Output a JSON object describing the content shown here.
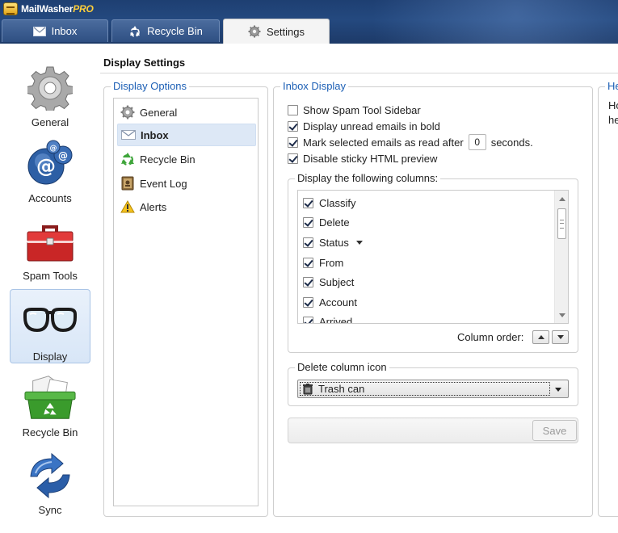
{
  "app": {
    "name_plain": "MailWasher",
    "name_brand": "PRO"
  },
  "tabs": [
    {
      "label": "Inbox",
      "icon": "envelope-icon"
    },
    {
      "label": "Recycle Bin",
      "icon": "recycle-icon"
    },
    {
      "label": "Settings",
      "icon": "gear-icon",
      "active": true
    }
  ],
  "nav": [
    {
      "label": "General",
      "icon": "gear-icon"
    },
    {
      "label": "Accounts",
      "icon": "at-sign-icon"
    },
    {
      "label": "Spam Tools",
      "icon": "toolbox-icon"
    },
    {
      "label": "Display",
      "icon": "glasses-icon",
      "selected": true
    },
    {
      "label": "Recycle Bin",
      "icon": "recycle-bin-icon"
    },
    {
      "label": "Sync",
      "icon": "sync-icon"
    }
  ],
  "page_title": "Display Settings",
  "display_options": {
    "heading": "Display Options",
    "items": [
      {
        "label": "General",
        "icon": "gear-icon"
      },
      {
        "label": "Inbox",
        "icon": "envelope-icon",
        "selected": true
      },
      {
        "label": "Recycle Bin",
        "icon": "recycle-icon"
      },
      {
        "label": "Event Log",
        "icon": "log-book-icon"
      },
      {
        "label": "Alerts",
        "icon": "warning-icon"
      }
    ]
  },
  "inbox_display": {
    "heading": "Inbox Display",
    "options": [
      {
        "label": "Show Spam Tool Sidebar",
        "checked": false
      },
      {
        "label": "Display unread emails in bold",
        "checked": true
      },
      {
        "label_before": "Mark selected emails as read after",
        "value": "0",
        "label_after": "seconds.",
        "checked": true
      },
      {
        "label": "Disable sticky HTML preview",
        "checked": true
      }
    ],
    "columns_heading": "Display the following columns:",
    "columns": [
      {
        "label": "Classify",
        "checked": true
      },
      {
        "label": "Delete",
        "checked": true
      },
      {
        "label": "Status",
        "checked": true,
        "sorted": true
      },
      {
        "label": "From",
        "checked": true
      },
      {
        "label": "Subject",
        "checked": true
      },
      {
        "label": "Account",
        "checked": true
      },
      {
        "label": "Arrived",
        "checked": true
      }
    ],
    "column_order_label": "Column order:",
    "delete_icon_heading": "Delete column icon",
    "delete_icon_value": "Trash can",
    "save_label": "Save"
  },
  "help": {
    "heading": "He",
    "line1": "Ho",
    "line2": "he"
  }
}
